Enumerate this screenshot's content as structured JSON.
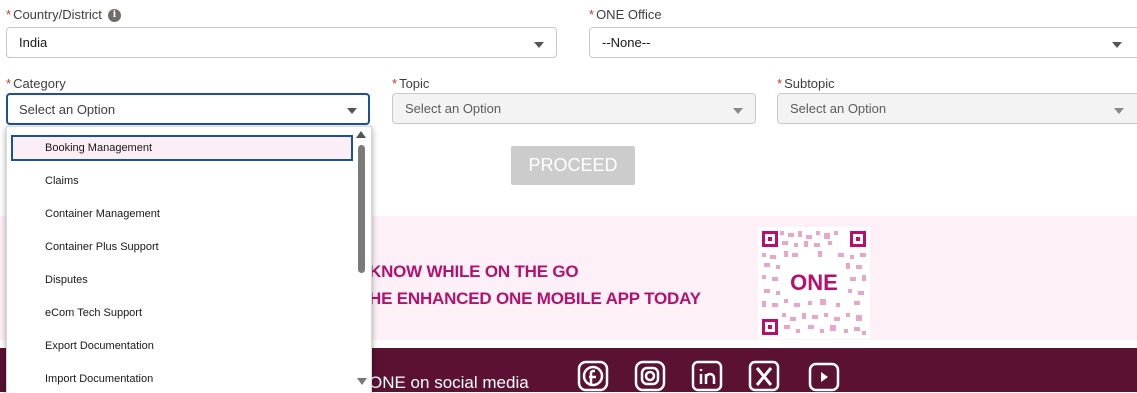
{
  "form": {
    "required_mark": "*",
    "country": {
      "label": "Country/District",
      "value": "India",
      "info_icon": "i"
    },
    "office": {
      "label": "ONE Office",
      "value": "--None--"
    },
    "category": {
      "label": "Category",
      "placeholder": "Select an Option"
    },
    "topic": {
      "label": "Topic",
      "placeholder": "Select an Option"
    },
    "subtopic": {
      "label": "Subtopic",
      "placeholder": "Select an Option"
    },
    "proceed_label": "PROCEED"
  },
  "dropdown": {
    "options": [
      "Booking Management",
      "Claims",
      "Container Management",
      "Container Plus Support",
      "Disputes",
      "eCom Tech Support",
      "Export Documentation",
      "Import Documentation"
    ],
    "selected_index": 0
  },
  "promo": {
    "line1": "KNOW WHILE ON THE GO",
    "line2": "HE ENHANCED ONE MOBILE APP TODAY",
    "qr_logo": "ONE"
  },
  "footer": {
    "text": "ONE on social media",
    "icons": [
      "facebook-icon",
      "instagram-icon",
      "linkedin-icon",
      "x-icon",
      "youtube-icon"
    ]
  },
  "colors": {
    "accent_blue": "#1b5297",
    "brand_magenta": "#b5106d",
    "footer_bg": "#5b1131",
    "promo_bg": "#fdf1f7"
  }
}
